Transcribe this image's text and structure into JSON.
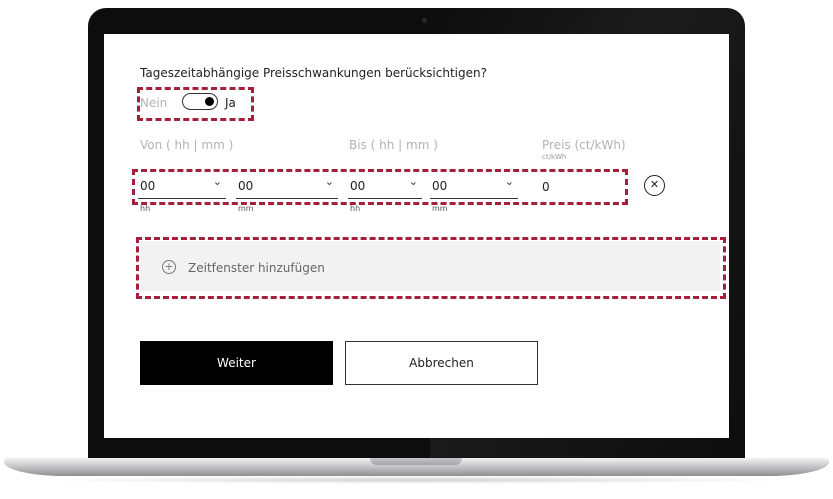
{
  "form": {
    "question": "Tageszeitabhängige Preisschwankungen berücksichtigen?",
    "toggle": {
      "off_label": "Nein",
      "on_label": "Ja",
      "state": "on"
    }
  },
  "time_window": {
    "from_header": "Von ( hh | mm )",
    "to_header": "Bis ( hh | mm )",
    "price_header": "Preis (ct/kWh)",
    "price_unit": "ct/kWh",
    "from_hours": {
      "value": "00",
      "unit": "hh"
    },
    "from_minutes": {
      "value": "00",
      "unit": "mm"
    },
    "to_hours": {
      "value": "00",
      "unit": "hh"
    },
    "to_minutes": {
      "value": "00",
      "unit": "mm"
    },
    "price_value": "0",
    "remove_icon": "close-circle-icon"
  },
  "add_window": {
    "label": "Zeitfenster hinzufügen",
    "icon": "plus-circle-icon"
  },
  "actions": {
    "next_label": "Weiter",
    "cancel_label": "Abbrechen"
  },
  "colors": {
    "highlight": "#a51e3a",
    "primary_button": "#000000",
    "add_area_bg": "#f2f2f2"
  }
}
